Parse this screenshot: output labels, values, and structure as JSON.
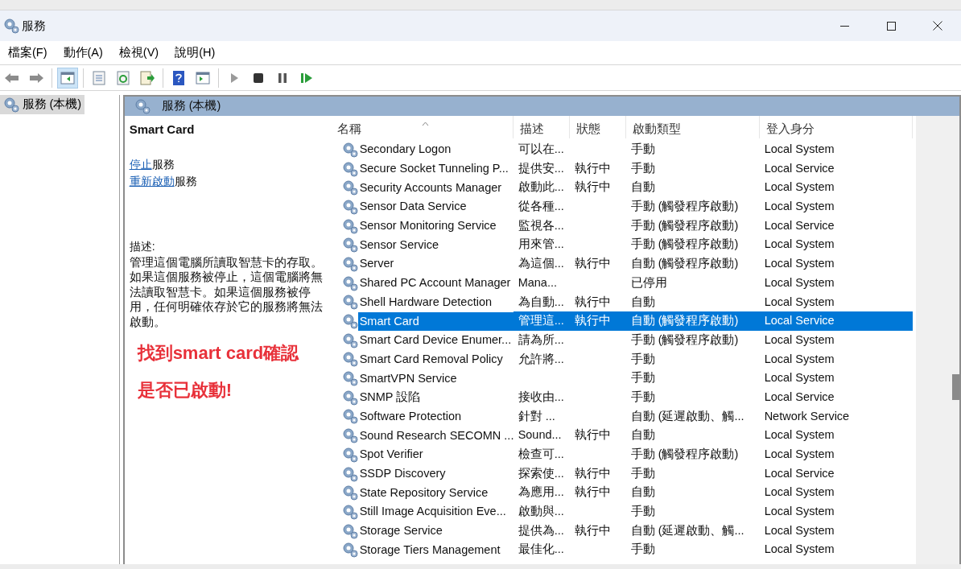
{
  "window": {
    "title": "服務"
  },
  "menu": [
    "檔案(F)",
    "動作(A)",
    "檢視(V)",
    "說明(H)"
  ],
  "toolbar": [
    {
      "kind": "back",
      "pressed": false
    },
    {
      "kind": "forward",
      "pressed": false
    },
    {
      "kind": "sep"
    },
    {
      "kind": "tree",
      "pressed": true
    },
    {
      "kind": "sep"
    },
    {
      "kind": "props",
      "pressed": false
    },
    {
      "kind": "refresh",
      "pressed": false
    },
    {
      "kind": "export",
      "pressed": false
    },
    {
      "kind": "sep"
    },
    {
      "kind": "help",
      "pressed": false
    },
    {
      "kind": "pane",
      "pressed": false
    },
    {
      "kind": "sep"
    },
    {
      "kind": "play",
      "pressed": false
    },
    {
      "kind": "stop",
      "pressed": false
    },
    {
      "kind": "pause",
      "pressed": false
    },
    {
      "kind": "resume",
      "pressed": false
    }
  ],
  "tree": {
    "items": [
      {
        "label": "服務 (本機)",
        "selected": true
      }
    ]
  },
  "panel": {
    "title": "服務 (本機)"
  },
  "details": {
    "name": "Smart Card",
    "actions": [
      {
        "link": "停止",
        "text": "服務"
      },
      {
        "link": "重新啟動",
        "text": "服務"
      }
    ],
    "description_label": "描述:",
    "description": "管理這個電腦所讀取智慧卡的存取。如果這個服務被停止，這個電腦將無法讀取智慧卡。如果這個服務被停用，任何明確依存於它的服務將無法啟動。",
    "annotation": [
      "找到smart card確認",
      "是否已啟動!"
    ]
  },
  "table": {
    "columns": [
      {
        "label": "名稱",
        "sorted": true
      },
      {
        "label": "描述",
        "sorted": false
      },
      {
        "label": "狀態",
        "sorted": false
      },
      {
        "label": "啟動類型",
        "sorted": false
      },
      {
        "label": "登入身分",
        "sorted": false
      }
    ],
    "rows": [
      {
        "name": "Secondary Logon",
        "description": "可以在...",
        "status": "",
        "startup_type": "手動",
        "log_on_as": "Local System",
        "selected": false
      },
      {
        "name": "Secure Socket Tunneling P...",
        "description": "提供安...",
        "status": "執行中",
        "startup_type": "手動",
        "log_on_as": "Local Service",
        "selected": false
      },
      {
        "name": "Security Accounts Manager",
        "description": "啟動此...",
        "status": "執行中",
        "startup_type": "自動",
        "log_on_as": "Local System",
        "selected": false
      },
      {
        "name": "Sensor Data Service",
        "description": "從各種...",
        "status": "",
        "startup_type": "手動 (觸發程序啟動)",
        "log_on_as": "Local System",
        "selected": false
      },
      {
        "name": "Sensor Monitoring Service",
        "description": "監視各...",
        "status": "",
        "startup_type": "手動 (觸發程序啟動)",
        "log_on_as": "Local Service",
        "selected": false
      },
      {
        "name": "Sensor Service",
        "description": "用來管...",
        "status": "",
        "startup_type": "手動 (觸發程序啟動)",
        "log_on_as": "Local System",
        "selected": false
      },
      {
        "name": "Server",
        "description": "為這個...",
        "status": "執行中",
        "startup_type": "自動 (觸發程序啟動)",
        "log_on_as": "Local System",
        "selected": false
      },
      {
        "name": "Shared PC Account Manager",
        "description": "Mana...",
        "status": "",
        "startup_type": "已停用",
        "log_on_as": "Local System",
        "selected": false
      },
      {
        "name": "Shell Hardware Detection",
        "description": "為自動...",
        "status": "執行中",
        "startup_type": "自動",
        "log_on_as": "Local System",
        "selected": false
      },
      {
        "name": "Smart Card",
        "description": "管理這...",
        "status": "執行中",
        "startup_type": "自動 (觸發程序啟動)",
        "log_on_as": "Local Service",
        "selected": true
      },
      {
        "name": "Smart Card Device Enumer...",
        "description": "請為所...",
        "status": "",
        "startup_type": "手動 (觸發程序啟動)",
        "log_on_as": "Local System",
        "selected": false
      },
      {
        "name": "Smart Card Removal Policy",
        "description": "允許將...",
        "status": "",
        "startup_type": "手動",
        "log_on_as": "Local System",
        "selected": false
      },
      {
        "name": "SmartVPN Service",
        "description": "",
        "status": "",
        "startup_type": "手動",
        "log_on_as": "Local System",
        "selected": false
      },
      {
        "name": "SNMP 設陷",
        "description": "接收由...",
        "status": "",
        "startup_type": "手動",
        "log_on_as": "Local Service",
        "selected": false
      },
      {
        "name": "Software Protection",
        "description": "針對 ...",
        "status": "",
        "startup_type": "自動 (延遲啟動、觸...",
        "log_on_as": "Network Service",
        "selected": false
      },
      {
        "name": "Sound Research SECOMN ...",
        "description": "Sound...",
        "status": "執行中",
        "startup_type": "自動",
        "log_on_as": "Local System",
        "selected": false
      },
      {
        "name": "Spot Verifier",
        "description": "檢查可...",
        "status": "",
        "startup_type": "手動 (觸發程序啟動)",
        "log_on_as": "Local System",
        "selected": false
      },
      {
        "name": "SSDP Discovery",
        "description": "探索使...",
        "status": "執行中",
        "startup_type": "手動",
        "log_on_as": "Local Service",
        "selected": false
      },
      {
        "name": "State Repository Service",
        "description": "為應用...",
        "status": "執行中",
        "startup_type": "自動",
        "log_on_as": "Local System",
        "selected": false
      },
      {
        "name": "Still Image Acquisition Eve...",
        "description": "啟動與...",
        "status": "",
        "startup_type": "手動",
        "log_on_as": "Local System",
        "selected": false
      },
      {
        "name": "Storage Service",
        "description": "提供為...",
        "status": "執行中",
        "startup_type": "自動 (延遲啟動、觸...",
        "log_on_as": "Local System",
        "selected": false
      },
      {
        "name": "Storage Tiers Management",
        "description": "最佳化...",
        "status": "",
        "startup_type": "手動",
        "log_on_as": "Local System",
        "selected": false
      }
    ]
  }
}
